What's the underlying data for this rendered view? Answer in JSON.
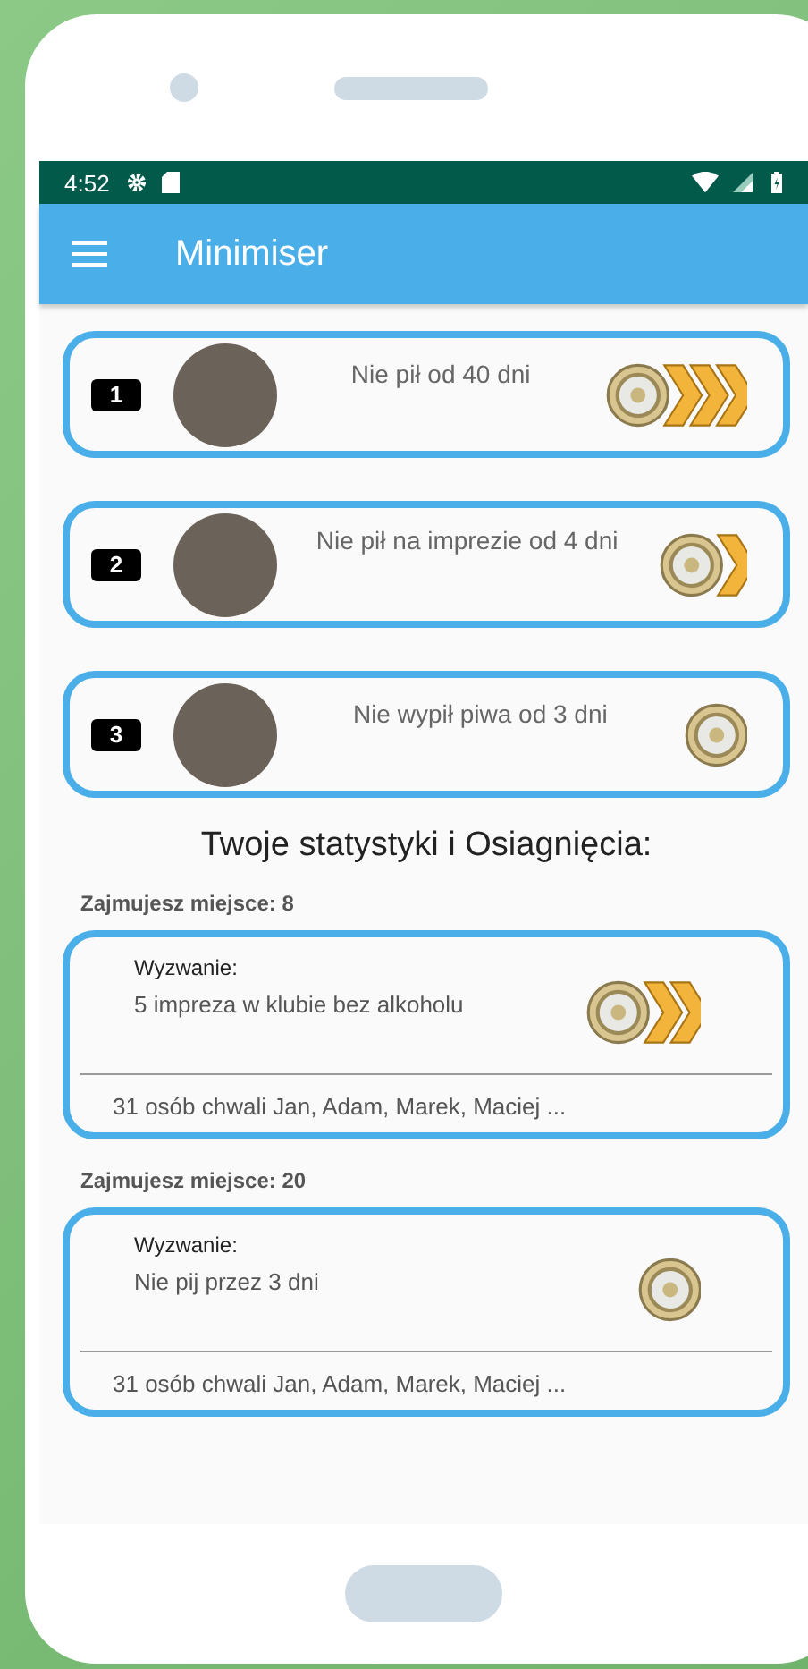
{
  "status_bar": {
    "time": "4:52"
  },
  "toolbar": {
    "title": "Minimiser"
  },
  "ranking": [
    {
      "rank": "1",
      "text": "Nie pił od 40 dni",
      "kind": "triple"
    },
    {
      "rank": "2",
      "text": "Nie pił na imprezie od 4 dni",
      "kind": "single"
    },
    {
      "rank": "3",
      "text": "Nie wypił piwa od 3 dni",
      "kind": "none"
    }
  ],
  "stats_heading": "Twoje statystyki i Osiagnięcia:",
  "challenges": [
    {
      "place": "Zajmujesz miejsce: 8",
      "label": "Wyzwanie:",
      "text": "5 impreza w klubie bez alkoholu",
      "kind": "double",
      "praise": "31 osób chwali Jan, Adam, Marek, Maciej  ..."
    },
    {
      "place": "Zajmujesz miejsce: 20",
      "label": "Wyzwanie:",
      "text": "Nie pij przez 3 dni",
      "kind": "none",
      "praise": "31 osób chwali Jan, Adam, Marek, Maciej  ..."
    }
  ]
}
